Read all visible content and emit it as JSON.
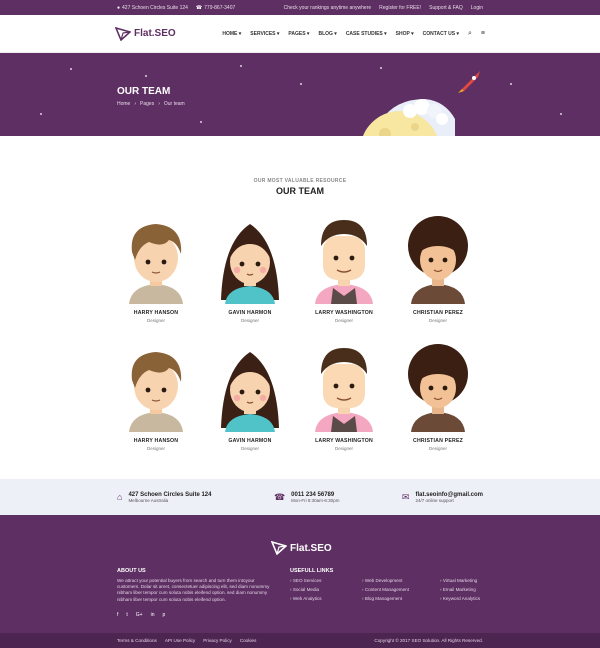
{
  "topbar": {
    "address": "427 Schoen Circles Suite 124",
    "phone": "779-867-3407",
    "check_text": "Check your rankings anytime anywhere",
    "register": "Register for FREE!",
    "support": "Support & FAQ",
    "login": "Login"
  },
  "brand": {
    "name": "Flat.SEO"
  },
  "nav": {
    "items": [
      "HOME",
      "SERVICES",
      "PAGES",
      "BLOG",
      "CASE STUDIES",
      "SHOP",
      "CONTACT US"
    ]
  },
  "hero": {
    "title": "OUR TEAM",
    "crumbs": [
      "Home",
      "Pages",
      "Our team"
    ]
  },
  "section": {
    "subtitle": "OUR MOST VALUABLE RESOURCE",
    "title": "OUR TEAM"
  },
  "team": [
    {
      "name": "HARRY HANSON",
      "role": "Designer",
      "avatar": "boy-shaggy"
    },
    {
      "name": "GAVIN HARMON",
      "role": "Designer",
      "avatar": "girl-bob"
    },
    {
      "name": "LARRY WASHINGTON",
      "role": "Designer",
      "avatar": "man-vest"
    },
    {
      "name": "CHRISTIAN PEREZ",
      "role": "Designer",
      "avatar": "man-afro"
    },
    {
      "name": "HARRY HANSON",
      "role": "Designer",
      "avatar": "boy-shaggy"
    },
    {
      "name": "GAVIN HARMON",
      "role": "Designer",
      "avatar": "girl-bob"
    },
    {
      "name": "LARRY WASHINGTON",
      "role": "Designer",
      "avatar": "man-vest"
    },
    {
      "name": "CHRISTIAN PEREZ",
      "role": "Designer",
      "avatar": "man-afro"
    }
  ],
  "contact": {
    "address": {
      "main": "427 Schoen Circles Suite 124",
      "sub": "Melbourne Australia",
      "icon": "map-marker-icon"
    },
    "phone": {
      "main": "0011 234 56789",
      "sub": "Mon-Fri 8:30am-6:30pm",
      "icon": "phone-icon"
    },
    "email": {
      "main": "flat.seoinfo@gmail.com",
      "sub": "24/7 online support",
      "icon": "envelope-icon"
    }
  },
  "footer": {
    "about_title": "ABOUT US",
    "about_text": "We attract your potential buyers from search and turn them intoyour customers. Dolar sit amet, consectetuer adipiscing elit, sed diam nonummy nibham liber tempor cum soluta nobis eleifend option. sed diam nonummy nibham liber tempor cum soluta nobis eleifend option.",
    "social": [
      "f",
      "t",
      "G+",
      "in",
      "p"
    ],
    "links_title": "USEFULL LINKS",
    "links": [
      "SEO Services",
      "Web Development",
      "Virtual Marketing",
      "Social Media",
      "Content Management",
      "Email Marketing",
      "Web Analytics",
      "Blog Management",
      "Keyword Analytics"
    ]
  },
  "bottom": {
    "links": [
      "Terms & Conditions",
      "API Use Policy",
      "Privacy Policy",
      "Cookies"
    ],
    "copyright": "Copyright © 2017 SEO Solution. All Rights Reserved."
  },
  "colors": {
    "brand": "#5e2f62",
    "footer_bottom": "#4d2551",
    "strip": "#eef0f8"
  }
}
